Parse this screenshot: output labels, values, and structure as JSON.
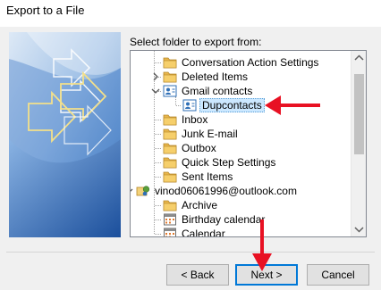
{
  "window": {
    "title": "Export to a File"
  },
  "prompt": "Select folder to export from:",
  "tree": {
    "items": [
      {
        "label": "Conversation Action Settings",
        "icon": "folder-icon",
        "level": 1,
        "expander": "none"
      },
      {
        "label": "Deleted Items",
        "icon": "folder-icon",
        "level": 1,
        "expander": "collapsed"
      },
      {
        "label": "Gmail contacts",
        "icon": "contacts-folder-icon",
        "level": 1,
        "expander": "expanded"
      },
      {
        "label": "Dupcontacts",
        "icon": "contacts-folder-icon",
        "level": 2,
        "expander": "none",
        "selected": true
      },
      {
        "label": "Inbox",
        "icon": "folder-icon",
        "level": 1,
        "expander": "none"
      },
      {
        "label": "Junk E-mail",
        "icon": "folder-icon",
        "level": 1,
        "expander": "none"
      },
      {
        "label": "Outbox",
        "icon": "folder-icon",
        "level": 1,
        "expander": "none"
      },
      {
        "label": "Quick Step Settings",
        "icon": "folder-icon",
        "level": 1,
        "expander": "none"
      },
      {
        "label": "Sent Items",
        "icon": "folder-icon",
        "level": 1,
        "expander": "none"
      },
      {
        "label": "vinod06061996@outlook.com",
        "icon": "mailbox-icon",
        "level": 0,
        "expander": "expanded"
      },
      {
        "label": "Archive",
        "icon": "folder-icon",
        "level": 1,
        "expander": "none"
      },
      {
        "label": "Birthday calendar",
        "icon": "calendar-icon",
        "level": 1,
        "expander": "none"
      },
      {
        "label": "Calendar",
        "icon": "calendar-icon",
        "level": 1,
        "expander": "none"
      }
    ]
  },
  "buttons": {
    "back": "< Back",
    "next": "Next >",
    "cancel": "Cancel"
  },
  "colors": {
    "annotation_arrow": "#e81123",
    "selection": "#cce8ff",
    "default_button_border": "#0078d7",
    "folder": "#e8b64c"
  }
}
